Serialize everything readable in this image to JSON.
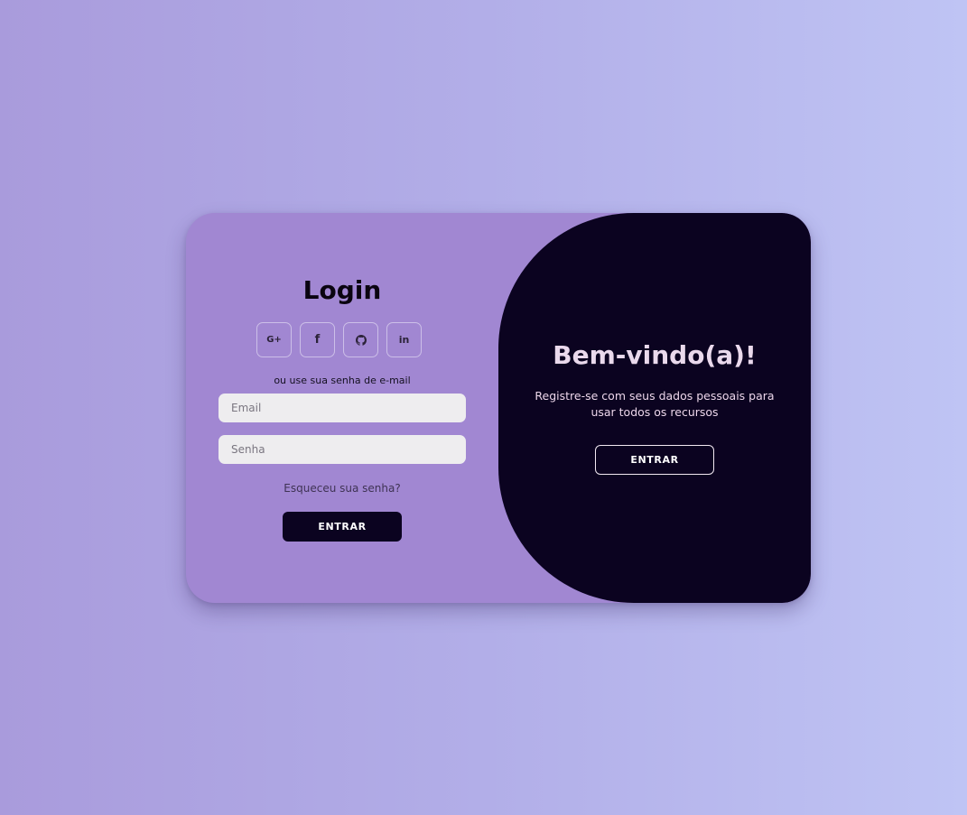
{
  "login": {
    "title": "Login",
    "socials": [
      {
        "label": "G+",
        "icon": "google-plus-icon"
      },
      {
        "label": "f",
        "icon": "facebook-icon"
      },
      {
        "label": "",
        "icon": "github-icon"
      },
      {
        "label": "in",
        "icon": "linkedin-icon"
      }
    ],
    "or_text": "ou use sua senha de e-mail",
    "email_placeholder": "Email",
    "email_value": "",
    "password_placeholder": "Senha",
    "password_value": "",
    "forgot_label": "Esqueceu sua senha?",
    "submit_label": "ENTRAR"
  },
  "welcome": {
    "title": "Bem-vindo(a)!",
    "text": "Registre-se com seus dados pessoais para usar todos os recursos",
    "button_label": "ENTRAR"
  },
  "colors": {
    "card_left": "#a187d2",
    "panel_dark": "#0b0320",
    "accent_text": "#ead9ec"
  }
}
